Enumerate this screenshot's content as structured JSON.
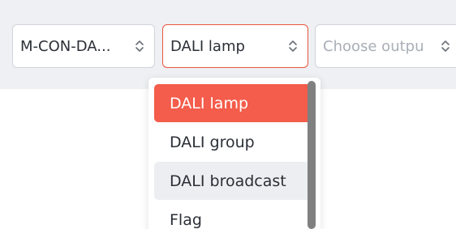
{
  "selects": {
    "device": {
      "value": "M-CON-DA..."
    },
    "type": {
      "value": "DALI lamp"
    },
    "output": {
      "placeholder": "Choose outpu"
    }
  },
  "dropdown": {
    "options": [
      {
        "label": "DALI lamp",
        "state": "selected"
      },
      {
        "label": "DALI group",
        "state": "normal"
      },
      {
        "label": "DALI broadcast",
        "state": "hover"
      },
      {
        "label": "Flag",
        "state": "normal"
      }
    ]
  },
  "colors": {
    "accent": "#f45c4b",
    "focus_border": "#e8553e",
    "toolbar_bg": "#eef0f3",
    "hover_bg": "#eceef1",
    "scrollbar": "#808080"
  },
  "icons": {
    "select_chevron": "chevron-up-down-icon"
  }
}
